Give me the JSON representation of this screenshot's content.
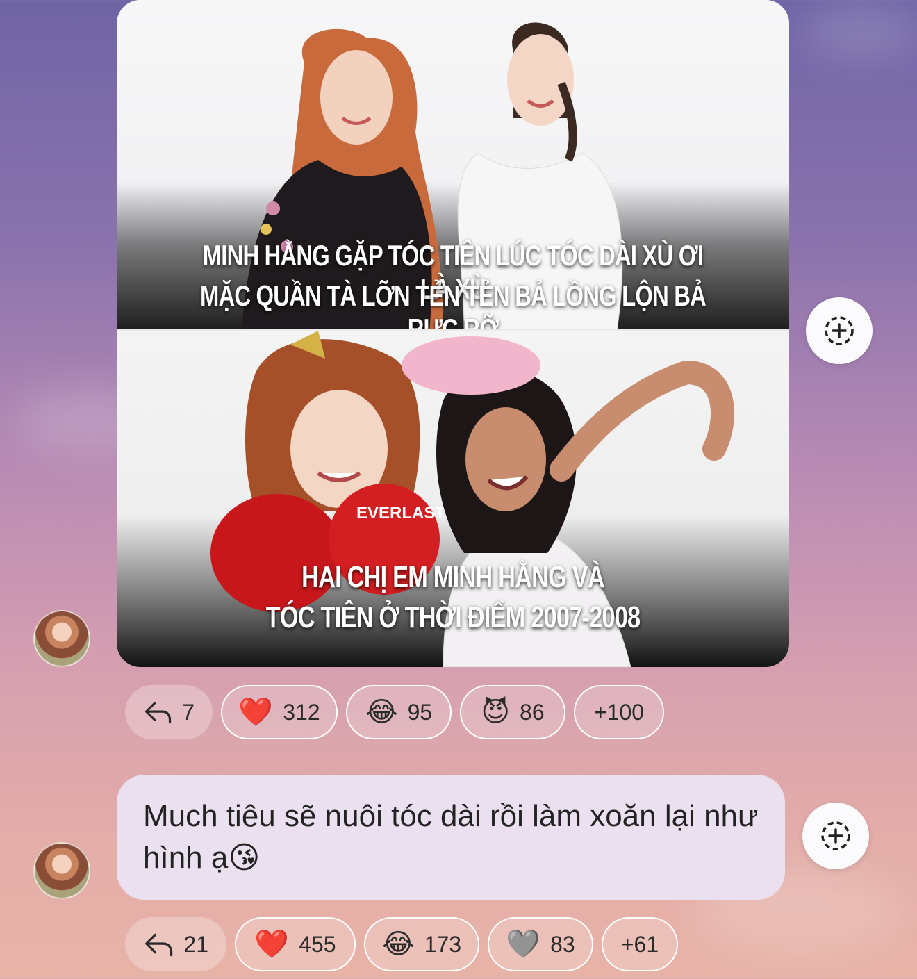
{
  "post_image": {
    "caption_top_line1": "MINH HẰNG GẶP TÓC TIÊN LÚC TÓC DÀI XÙ ƠI LÀ XÙ",
    "caption_top_line2": "MẶC QUẦN TÀ LỠN TẺN TẺN BẢ LỒNG LỘN BẢ RỰC RỠ",
    "caption_bottom_line1": "HAI CHỊ EM MINH HẰNG VÀ",
    "caption_bottom_line2": "TÓC TIÊN Ở THỜI ĐIỂM 2007-2008",
    "glove_brand": "EVERLAST"
  },
  "reactions_1": {
    "reply_count": "7",
    "items": [
      {
        "emoji": "❤️",
        "count": "312"
      },
      {
        "emoji": "😂",
        "count": "95"
      },
      {
        "emoji": "😈",
        "count": "86"
      }
    ],
    "more": "+100"
  },
  "message_text": "Much tiêu sẽ nuôi tóc dài rồi làm xoăn lại như hình ạ😘",
  "reactions_2": {
    "reply_count": "21",
    "items": [
      {
        "emoji": "❤️",
        "count": "455"
      },
      {
        "emoji": "😂",
        "count": "173"
      },
      {
        "emoji": "🩶",
        "count": "83"
      }
    ],
    "more": "+61"
  },
  "icons": {
    "reply": "reply-arrow-icon",
    "add_reaction": "add-reaction-icon"
  }
}
